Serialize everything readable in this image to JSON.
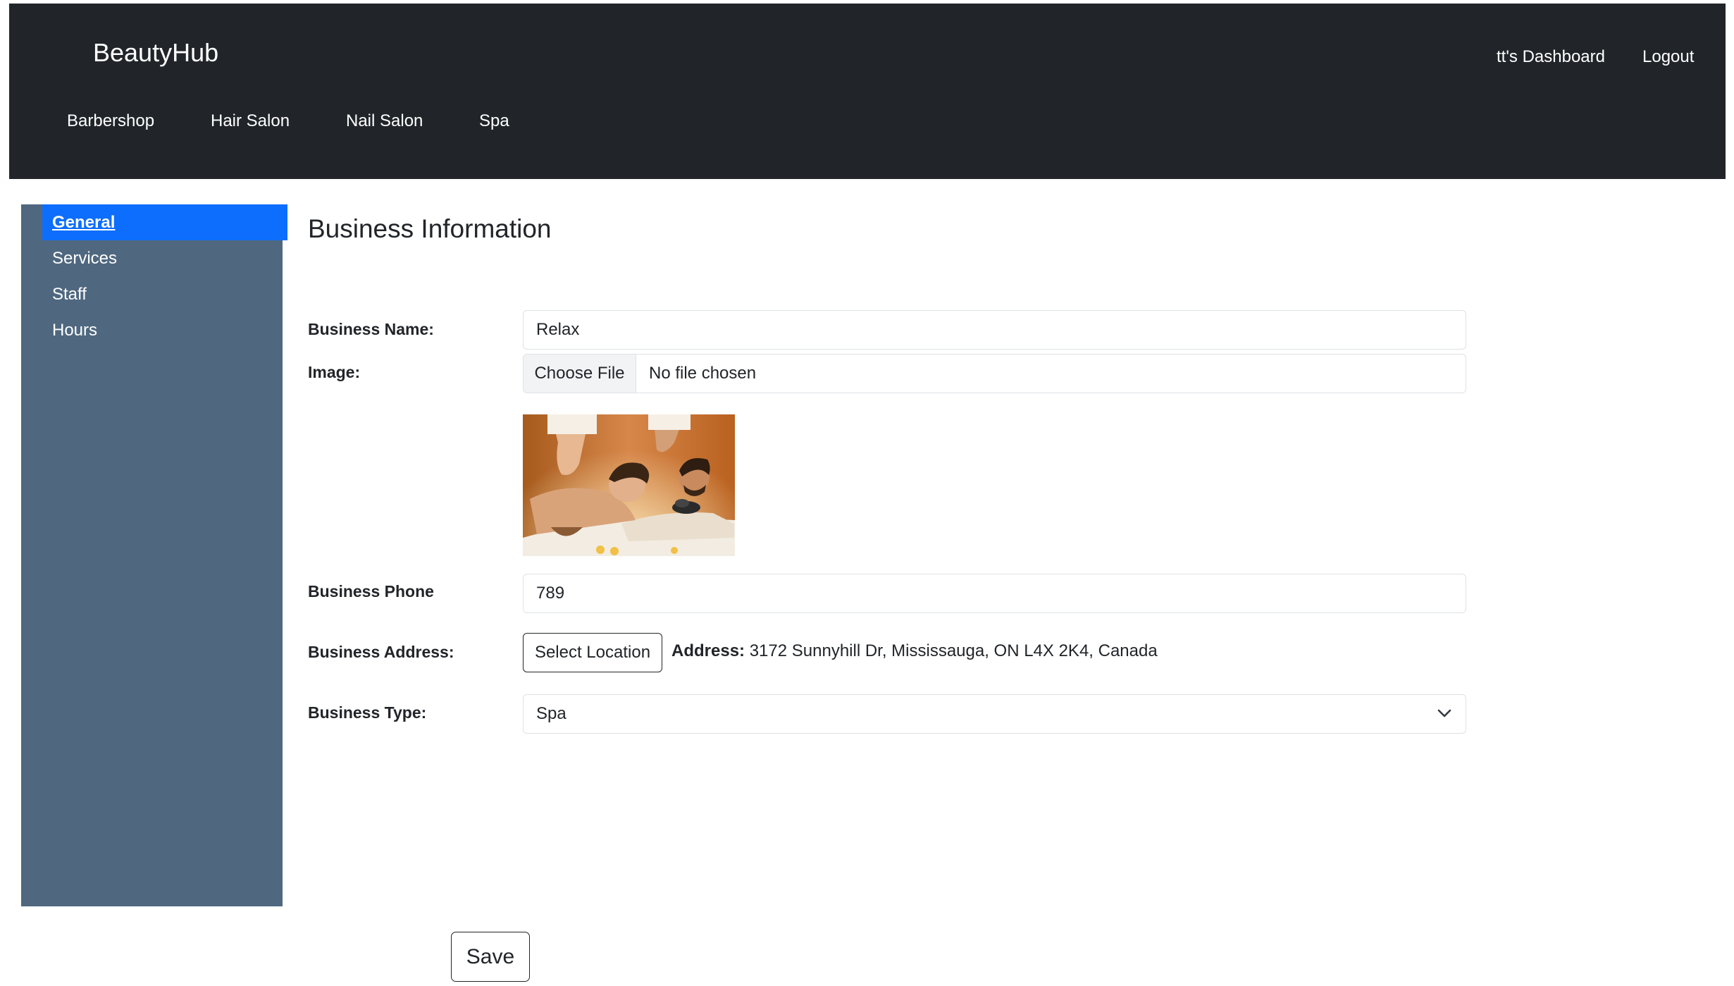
{
  "navbar": {
    "brand": "BeautyHub",
    "dashboard_link": "tt's Dashboard",
    "logout_link": "Logout",
    "categories": [
      {
        "label": "Barbershop"
      },
      {
        "label": "Hair Salon"
      },
      {
        "label": "Nail Salon"
      },
      {
        "label": "Spa"
      }
    ]
  },
  "sidebar": {
    "items": [
      {
        "label": "General",
        "active": true
      },
      {
        "label": "Services",
        "active": false
      },
      {
        "label": "Staff",
        "active": false
      },
      {
        "label": "Hours",
        "active": false
      }
    ]
  },
  "main": {
    "title": "Business Information",
    "form": {
      "business_name": {
        "label": "Business Name:",
        "value": "Relax"
      },
      "image": {
        "label": "Image:",
        "button_label": "Choose File",
        "file_status": "No file chosen",
        "preview_description": "spa-massage-photo"
      },
      "business_phone": {
        "label": "Business Phone",
        "value": "789"
      },
      "business_address": {
        "label": "Business Address:",
        "button_label": "Select Location",
        "address_prefix": "Address:",
        "address_value": "3172 Sunnyhill Dr, Mississauga, ON L4X 2K4, Canada"
      },
      "business_type": {
        "label": "Business Type:",
        "selected": "Spa"
      }
    },
    "save_label": "Save"
  },
  "colors": {
    "navbar_bg": "#212529",
    "sidebar_bg": "#4f6880",
    "active_item_bg": "#0d6efd",
    "text": "#212529"
  }
}
